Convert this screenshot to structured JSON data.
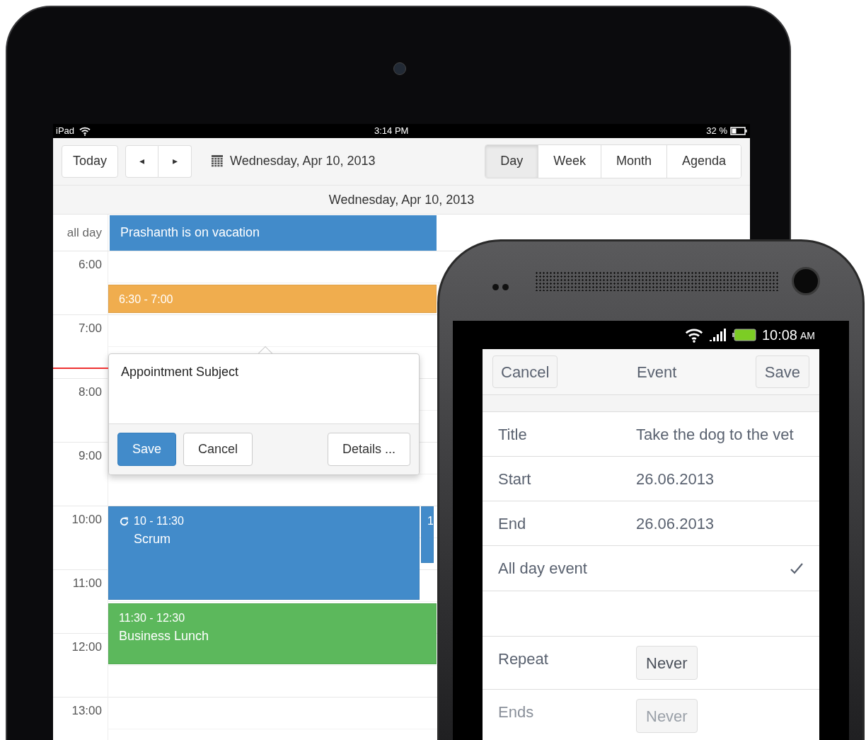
{
  "tablet": {
    "status_bar": {
      "device": "iPad",
      "time": "3:14 PM",
      "battery": "32 %"
    },
    "toolbar": {
      "today": "Today",
      "prev": "◂",
      "next": "▸",
      "date": "Wednesday, Apr 10, 2013"
    },
    "views": [
      {
        "label": "Day",
        "selected": true
      },
      {
        "label": "Week",
        "selected": false
      },
      {
        "label": "Month",
        "selected": false
      },
      {
        "label": "Agenda",
        "selected": false
      }
    ],
    "day_header": "Wednesday, Apr 10, 2013",
    "all_day_label": "all day",
    "all_day_event": {
      "title": "Prashanth is on vacation",
      "color": "#428bca"
    },
    "hours": [
      "6:00",
      "7:00",
      "8:00",
      "9:00",
      "10:00",
      "11:00",
      "12:00",
      "13:00"
    ],
    "events": [
      {
        "time": "6:30 - 7:00",
        "color": "#f0ad4e",
        "recurring": false
      },
      {
        "time": "10 - 11:30",
        "title": "Scrum",
        "color": "#428bca",
        "recurring": true
      },
      {
        "time": "1",
        "color": "#428bca",
        "recurring": false
      },
      {
        "time": "11:30 - 12:30",
        "title": "Business Lunch",
        "color": "#5cb85c",
        "recurring": false
      }
    ],
    "popup": {
      "subject": "Appointment Subject",
      "buttons": [
        {
          "label": "Save",
          "kind": "primary"
        },
        {
          "label": "Cancel",
          "kind": "default"
        },
        {
          "label": "Details ...",
          "kind": "default"
        }
      ]
    }
  },
  "phone": {
    "status_bar": {
      "time": "10:08",
      "meridiem": "AM"
    },
    "nav": {
      "cancel": "Cancel",
      "title": "Event",
      "save": "Save"
    },
    "rows": [
      {
        "kind": "text",
        "label": "Title",
        "value": "Take the dog to the vet"
      },
      {
        "kind": "text",
        "label": "Start",
        "value": "26.06.2013"
      },
      {
        "kind": "text",
        "label": "End",
        "value": "26.06.2013"
      },
      {
        "kind": "check",
        "label": "All day event",
        "checked": true
      },
      {
        "kind": "blank"
      },
      {
        "kind": "select",
        "label": "Repeat",
        "value": "Never",
        "disabled": false
      },
      {
        "kind": "select",
        "label": "Ends",
        "value": "Never",
        "disabled": true
      }
    ]
  }
}
